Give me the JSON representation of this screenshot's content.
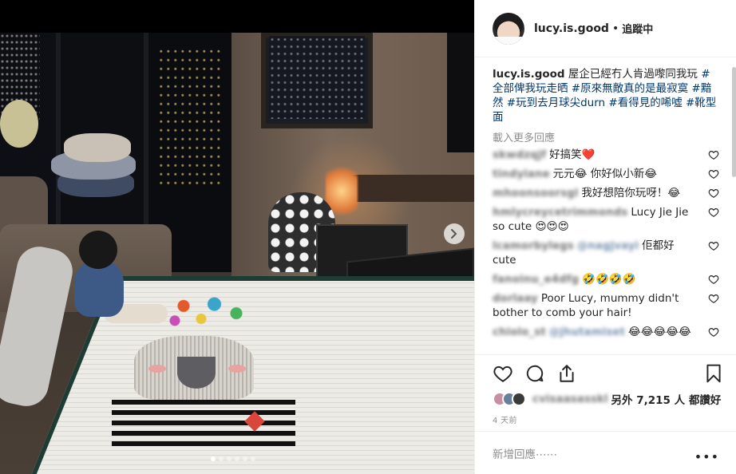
{
  "post": {
    "username": "lucy.is.good",
    "separator": "•",
    "follow_status": "追蹤中",
    "caption_text": "屋企已經冇人肯過嚟同我玩",
    "caption_tags": "#全部俾我玩走晒 #原來無敵真的是最寂寞 #黯然 #玩到去月球尖durn #看得見的唏噓 #靴型面",
    "load_more": "載入更多回應",
    "comments": [
      {
        "user": "skwdzqjf",
        "text": "好搞笑❤️"
      },
      {
        "user": "tindyiane",
        "text": "元元😂 你好似小新😂"
      },
      {
        "user": "mhoonsoorsgl",
        "text": "我好想陪你玩呀！😂"
      },
      {
        "user": "hmlycreycetrimmonds",
        "text": "Lucy Jie Jie so cute 😍😍😍"
      },
      {
        "user": "lcamorbylegs",
        "text": "佢都好cute",
        "mention": "@nagjvayi"
      },
      {
        "user": "fanoinu_e4dfg",
        "text": "🤣🤣🤣🤣"
      },
      {
        "user": "dorlaay",
        "text": "Poor Lucy, mummy didn't bother to comb your hair!"
      },
      {
        "user": "chiolo_st",
        "text": "😂😂😂😂😂",
        "mention": "@jhutamiset"
      }
    ],
    "likes_blurred_user": "cvisaasasskl",
    "likes_text": "另外 7,215 人 都讚好",
    "time_ago": "4 天前",
    "add_comment_placeholder": "新增回應⋯⋯",
    "more_label": "•••",
    "carousel": {
      "count": 6,
      "active_index": 0
    }
  },
  "colors": {
    "link": "#00376b",
    "muted": "#8e8e8e",
    "text": "#262626"
  }
}
